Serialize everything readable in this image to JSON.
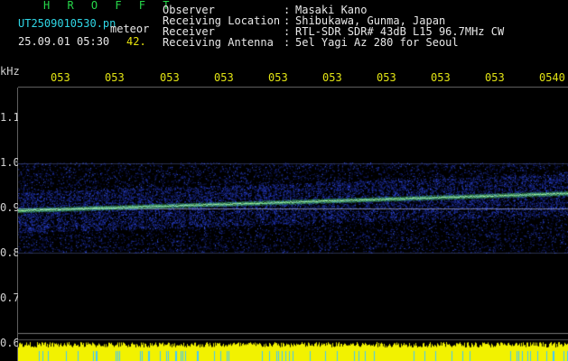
{
  "header": {
    "program": "H R O F F T",
    "filename": "UT2509010530.pn",
    "meteor_label": "meteor",
    "datetime": "25.09.01 05:30",
    "count": "42.",
    "fields": [
      {
        "label": "Observer",
        "sep": ":",
        "value": "Masaki Kano"
      },
      {
        "label": "Receiving Location",
        "sep": ":",
        "value": "Shibukawa, Gunma, Japan"
      },
      {
        "label": "Receiver",
        "sep": ":",
        "value": "RTL-SDR SDR# 43dB L15 96.7MHz CW"
      },
      {
        "label": "Receiving Antenna",
        "sep": ":",
        "value": "5el Yagi Az 280 for Seoul"
      }
    ]
  },
  "time_axis": {
    "ticks": [
      "053",
      "053",
      "053",
      "053",
      "053",
      "053",
      "053",
      "053",
      "053",
      "0540"
    ]
  },
  "freq_axis": {
    "unit": "kHz",
    "ticks": [
      "1.1",
      "1.0",
      "0.9",
      "0.8",
      "0.7",
      "0.6"
    ]
  },
  "colors": {
    "background": "#000000",
    "echo_trace": "#7df07a",
    "noise": "#1a2fb0",
    "bottom_band": "#f2f200",
    "label_yellow": "#e7e20c",
    "label_cyan": "#2fd7e6",
    "program_green": "#27d84a"
  }
}
